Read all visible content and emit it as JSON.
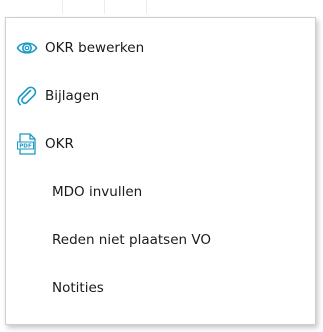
{
  "colors": {
    "accent": "#1a9bc4",
    "text": "#1a1a1a",
    "border": "#cfcfcf"
  },
  "menu": {
    "items": [
      {
        "label": "OKR bewerken",
        "icon": "eye-icon"
      },
      {
        "label": "Bijlagen",
        "icon": "paperclip-icon"
      },
      {
        "label": "OKR",
        "icon": "pdf-file-icon"
      },
      {
        "label": "MDO invullen",
        "icon": null
      },
      {
        "label": "Reden niet plaatsen VO",
        "icon": null
      },
      {
        "label": "Notities",
        "icon": null
      }
    ]
  }
}
